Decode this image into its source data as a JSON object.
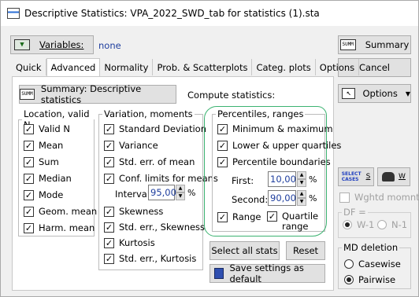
{
  "window": {
    "title": "Descriptive Statistics: VPA_2022_SWD_tab for statistics (1).sta"
  },
  "toolbar": {
    "variables_label": "Variables:",
    "variables_value": "none",
    "summary_label": "Summary",
    "cancel_label": "Cancel",
    "options_label": "Options"
  },
  "tabs": [
    "Quick",
    "Advanced",
    "Normality",
    "Prob. & Scatterplots",
    "Categ. plots",
    "Options"
  ],
  "panel": {
    "summary_button": "Summary: Descriptive statistics",
    "compute_label": "Compute statistics:",
    "location": {
      "legend": "Location, valid N",
      "items": [
        "Valid N",
        "Mean",
        "Sum",
        "Median",
        "Mode",
        "Geom. mean",
        "Harm. mean"
      ]
    },
    "variation": {
      "legend": "Variation, moments",
      "items": [
        "Standard Deviation",
        "Variance",
        "Std. err. of mean",
        "Conf. limits for means"
      ],
      "interval_label": "Interval:",
      "interval_value": "95,00",
      "pct": "%",
      "items2": [
        "Skewness",
        "Std. err., Skewness",
        "Kurtosis",
        "Std. err., Kurtosis"
      ]
    },
    "percentiles": {
      "legend": "Percentiles, ranges",
      "items": [
        "Minimum & maximum",
        "Lower & upper quartiles",
        "Percentile boundaries"
      ],
      "first_label": "First:",
      "first_value": "10,00",
      "second_label": "Second:",
      "second_value": "90,00",
      "pct": "%",
      "range_label": "Range",
      "quartile_line1": "Quartile",
      "quartile_line2": "range"
    },
    "select_all": "Select all stats",
    "reset": "Reset",
    "save_settings": "Save settings as default"
  },
  "side": {
    "select_line1": "SELECT",
    "select_line2": "CASES",
    "select_s": "S",
    "w_label": "W",
    "weighted": "Wghtd momnts",
    "df_legend": "DF =",
    "df_w1": "W-1",
    "df_n1": "N-1",
    "md_legend": "MD deletion",
    "casewise": "Casewise",
    "pairwise": "Pairwise"
  },
  "colors": {
    "accent": "#0078d7",
    "annotation": "#3cb371",
    "value_text": "#1e3e9e"
  }
}
